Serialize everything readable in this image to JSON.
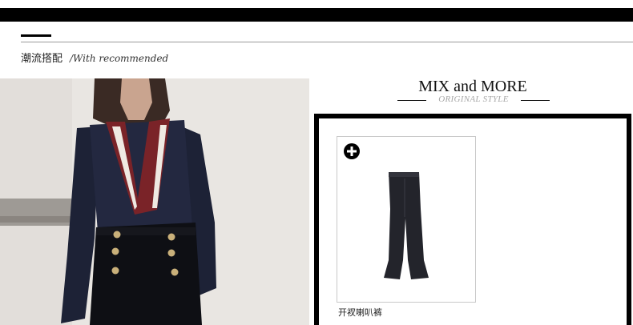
{
  "section": {
    "title_cn": "潮流搭配",
    "title_en": "/With recommended"
  },
  "feature": {
    "title": "MIX and MORE",
    "subtitle": "ORIGINAL STYLE"
  },
  "products": [
    {
      "name": "开衩喇叭裤",
      "icon": "plus-circle-icon"
    }
  ],
  "colors": {
    "accent": "#000000",
    "divider": "#9a9a9a",
    "subtitle": "#a8a8a8"
  }
}
